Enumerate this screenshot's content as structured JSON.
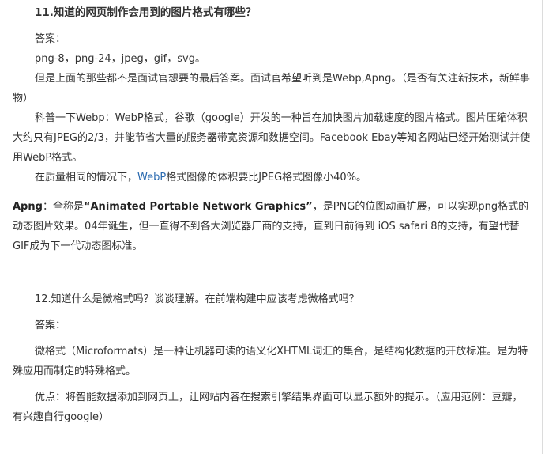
{
  "q11": {
    "title": "11.知道的网页制作会用到的图片格式有哪些？",
    "answer_label": "答案：",
    "formats": "png-8，png-24，jpeg，gif，svg。",
    "para1": "但是上面的那些都不是面试官想要的最后答案。面试官希望听到是Webp,Apng。（是否有关注新技术，新鲜事物）",
    "para2": "科普一下Webp：WebP格式，谷歌（google）开发的一种旨在加快图片加载速度的图片格式。图片压缩体积大约只有JPEG的2/3，并能节省大量的服务器带宽资源和数据空间。Facebook Ebay等知名网站已经开始测试并使用WebP格式。",
    "para3_pre": "在质量相同的情况下，",
    "para3_link": "WebP",
    "para3_post": "格式图像的体积要比JPEG格式图像小40%。",
    "apng_label": "Apng",
    "apng_mid": "：全称是",
    "apng_full": "“Animated Portable Network Graphics”",
    "apng_rest": "，是PNG的位图动画扩展，可以实现png格式的动态图片效果。04年诞生，但一直得不到各大浏览器厂商的支持，直到日前得到 iOS safari 8的支持，有望代替GIF成为下一代动态图标准。"
  },
  "q12": {
    "title": "12.知道什么是微格式吗？谈谈理解。在前端构建中应该考虑微格式吗？",
    "answer_label": "答案：",
    "para1": "微格式（Microformats）是一种让机器可读的语义化XHTML词汇的集合，是结构化数据的开放标准。是为特殊应用而制定的特殊格式。",
    "para2": "优点：将智能数据添加到网页上，让网站内容在搜索引擎结果界面可以显示额外的提示。（应用范例：豆瓣，有兴趣自行google）"
  }
}
